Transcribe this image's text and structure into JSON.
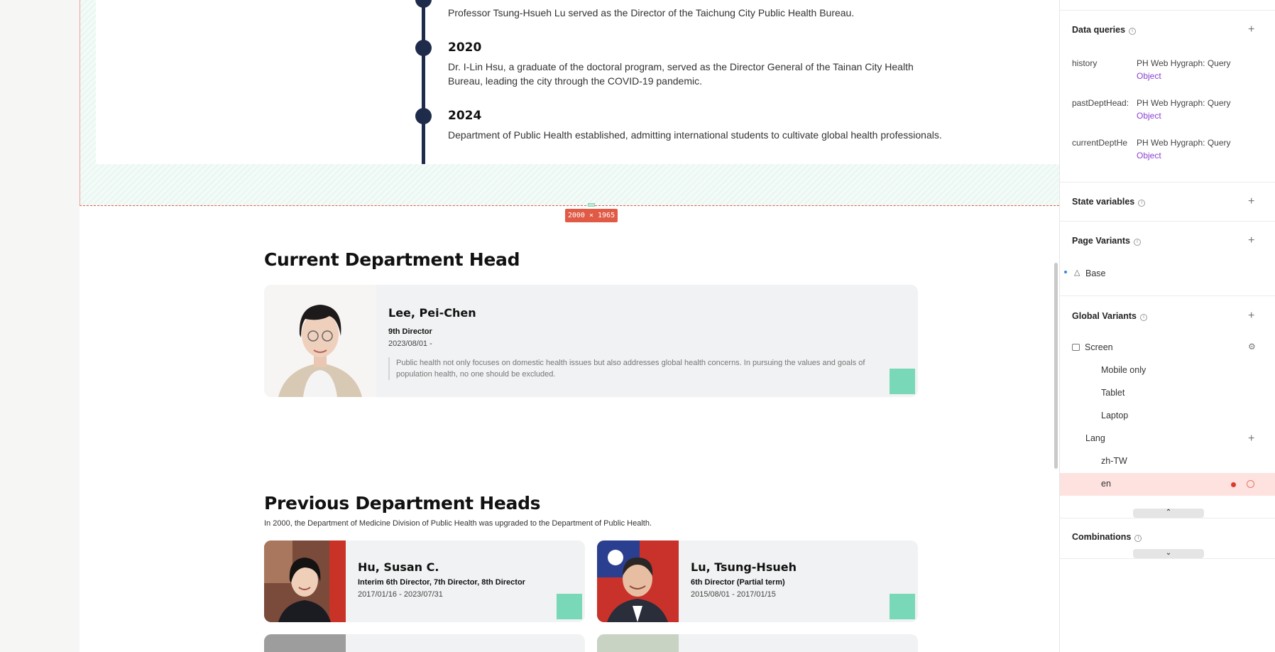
{
  "canvas": {
    "frame_size_badge": "2000 × 1965",
    "timeline": [
      {
        "year": "",
        "text": "Professor Tsung-Hsueh Lu served as the Director of the Taichung City Public Health Bureau."
      },
      {
        "year": "2020",
        "text": "Dr. I-Lin Hsu, a graduate of the doctoral program, served as the Director General of the Tainan City Health Bureau, leading the city through the COVID-19 pandemic."
      },
      {
        "year": "2024",
        "text": "Department of Public Health established, admitting international students to cultivate global health professionals."
      }
    ],
    "current_head": {
      "section_title": "Current Department Head",
      "name": "Lee, Pei-Chen",
      "role": "9th Director",
      "date": "2023/08/01 -",
      "quote": "Public health not only focuses on domestic health issues but also addresses global health concerns. In pursuing the values and goals of population health, no one should be excluded."
    },
    "previous_heads": {
      "section_title": "Previous Department Heads",
      "subtitle": "In 2000, the Department of Medicine Division of Public Health was upgraded to the Department of Public Health.",
      "cards": [
        {
          "name": "Hu, Susan C.",
          "role": "Interim 6th Director, 7th Director, 8th Director",
          "date": "2017/01/16 - 2023/07/31"
        },
        {
          "name": "Lu, Tsung-Hsueh",
          "role": "6th Director (Partial term)",
          "date": "2015/08/01 - 2017/01/15"
        }
      ]
    }
  },
  "panel": {
    "data_queries": {
      "title": "Data queries",
      "items": [
        {
          "key": "history",
          "source": "PH Web Hygraph: Query",
          "type": "Object"
        },
        {
          "key": "pastDeptHead:",
          "source": "PH Web Hygraph: Query",
          "type": "Object"
        },
        {
          "key": "currentDeptHe",
          "source": "PH Web Hygraph: Query",
          "type": "Object"
        }
      ]
    },
    "state_variables": {
      "title": "State variables"
    },
    "page_variants": {
      "title": "Page Variants",
      "items": [
        "Base"
      ]
    },
    "global_variants": {
      "title": "Global Variants",
      "groups": [
        {
          "name": "Screen",
          "options": [
            "Mobile only",
            "Tablet",
            "Laptop"
          ]
        },
        {
          "name": "Lang",
          "options": [
            "zh-TW",
            "en"
          ]
        }
      ],
      "active_option": "en"
    },
    "combinations": {
      "title": "Combinations"
    },
    "colors": {
      "accent": "#e05a45",
      "query_type": "#8a3fd1",
      "active_row_bg": "#fde2df"
    }
  }
}
